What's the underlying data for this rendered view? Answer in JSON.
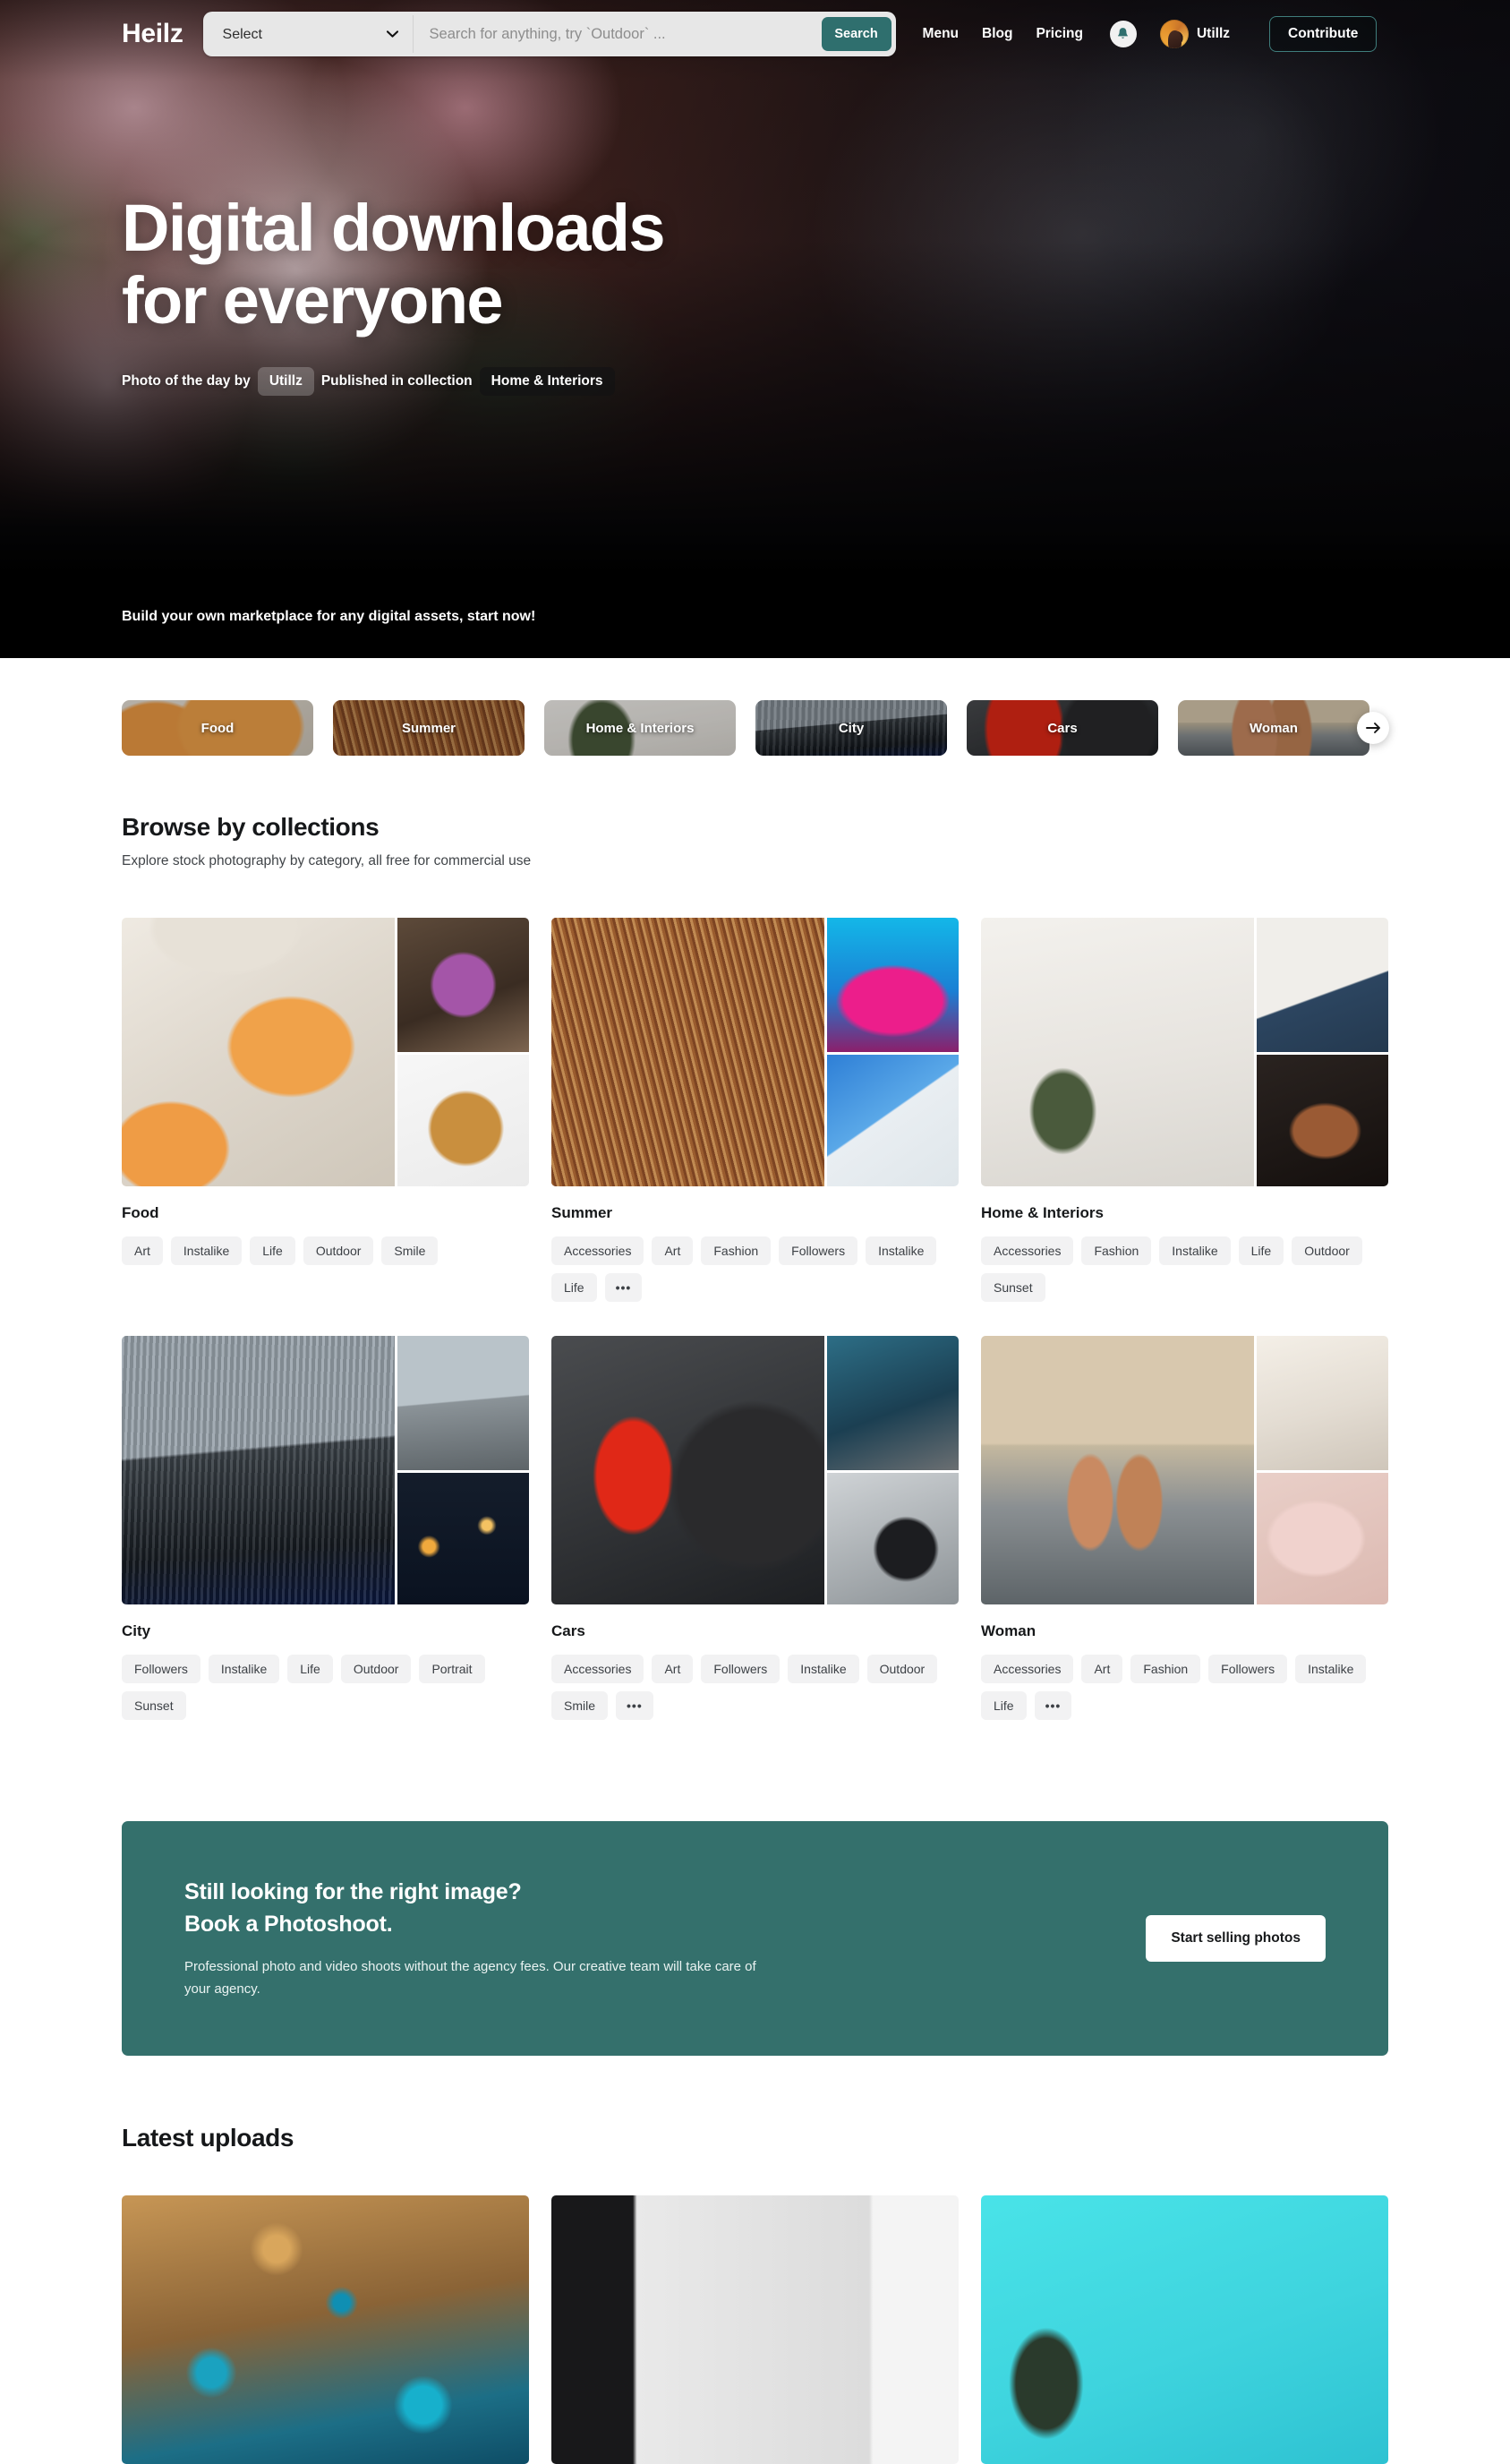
{
  "header": {
    "logo": "Heilz",
    "select_value": "Select",
    "select_options": [
      "Select"
    ],
    "search_placeholder": "Search for anything, try `Outdoor` ...",
    "search_value": "",
    "search_button": "Search",
    "nav": [
      {
        "label": "Menu",
        "name": "nav-menu"
      },
      {
        "label": "Blog",
        "name": "nav-blog"
      },
      {
        "label": "Pricing",
        "name": "nav-pricing"
      }
    ],
    "notification_icon": "bell-icon",
    "user_name": "Utillz",
    "contribute_label": "Contribute",
    "accent_color": "#2f6f6e"
  },
  "hero": {
    "title": "Digital downloads\nfor everyone",
    "credit_prefix": "Photo of the day by",
    "author": "Utillz",
    "credit_middle": "Published in collection",
    "collection": "Home & Interiors"
  },
  "promo_strip": {
    "text": "Build your own marketplace for any digital assets, start now!"
  },
  "category_strip": {
    "items": [
      {
        "label": "Food",
        "ph": "ph-food-a"
      },
      {
        "label": "Summer",
        "ph": "ph-sum-a"
      },
      {
        "label": "Home & Interiors",
        "ph": "ph-hi-a"
      },
      {
        "label": "City",
        "ph": "ph-city-a"
      },
      {
        "label": "Cars",
        "ph": "ph-cars-a"
      },
      {
        "label": "Woman",
        "ph": "ph-wom-a"
      }
    ],
    "next_icon": "arrow-right-icon"
  },
  "collections_section": {
    "title": "Browse by collections",
    "subtitle": "Explore stock photography by category, all free for commercial use",
    "items": [
      {
        "name": "Food",
        "ph": [
          "ph-food-a",
          "ph-food-b",
          "ph-food-c"
        ],
        "tags": [
          "Art",
          "Instalike",
          "Life",
          "Outdoor",
          "Smile"
        ]
      },
      {
        "name": "Summer",
        "ph": [
          "ph-sum-a",
          "ph-sum-b",
          "ph-sum-c"
        ],
        "tags": [
          "Accessories",
          "Art",
          "Fashion",
          "Followers",
          "Instalike",
          "Life",
          "•••"
        ]
      },
      {
        "name": "Home & Interiors",
        "ph": [
          "ph-hi-a",
          "ph-hi-b",
          "ph-hi-c"
        ],
        "tags": [
          "Accessories",
          "Fashion",
          "Instalike",
          "Life",
          "Outdoor",
          "Sunset"
        ]
      },
      {
        "name": "City",
        "ph": [
          "ph-city-a",
          "ph-city-b",
          "ph-city-c"
        ],
        "tags": [
          "Followers",
          "Instalike",
          "Life",
          "Outdoor",
          "Portrait",
          "Sunset"
        ]
      },
      {
        "name": "Cars",
        "ph": [
          "ph-cars-a",
          "ph-cars-b",
          "ph-cars-c"
        ],
        "tags": [
          "Accessories",
          "Art",
          "Followers",
          "Instalike",
          "Outdoor",
          "Smile",
          "•••"
        ]
      },
      {
        "name": "Woman",
        "ph": [
          "ph-wom-a",
          "ph-wom-b",
          "ph-wom-c"
        ],
        "tags": [
          "Accessories",
          "Art",
          "Fashion",
          "Followers",
          "Instalike",
          "Life",
          "•••"
        ]
      }
    ]
  },
  "cta": {
    "headline_1": "Still looking for the right image?",
    "headline_2": "Book a Photoshoot.",
    "body": "Professional photo and video shoots without the agency fees. Our creative team will take care of your agency.",
    "button": "Start selling photos",
    "bg_color": "#34706c"
  },
  "latest_section": {
    "title": "Latest uploads",
    "items": [
      {
        "ph": "ph-lat-a"
      },
      {
        "ph": "ph-lat-b"
      },
      {
        "ph": "ph-lat-c"
      }
    ]
  }
}
